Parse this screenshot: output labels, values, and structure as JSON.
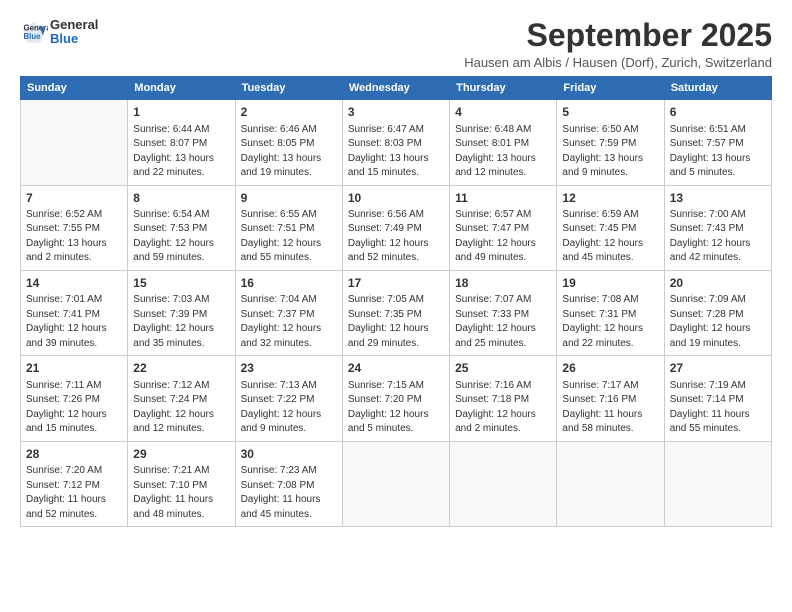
{
  "header": {
    "logo_general": "General",
    "logo_blue": "Blue",
    "month_title": "September 2025",
    "location": "Hausen am Albis / Hausen (Dorf), Zurich, Switzerland"
  },
  "days_of_week": [
    "Sunday",
    "Monday",
    "Tuesday",
    "Wednesday",
    "Thursday",
    "Friday",
    "Saturday"
  ],
  "weeks": [
    [
      {
        "day": "",
        "info": ""
      },
      {
        "day": "1",
        "info": "Sunrise: 6:44 AM\nSunset: 8:07 PM\nDaylight: 13 hours\nand 22 minutes."
      },
      {
        "day": "2",
        "info": "Sunrise: 6:46 AM\nSunset: 8:05 PM\nDaylight: 13 hours\nand 19 minutes."
      },
      {
        "day": "3",
        "info": "Sunrise: 6:47 AM\nSunset: 8:03 PM\nDaylight: 13 hours\nand 15 minutes."
      },
      {
        "day": "4",
        "info": "Sunrise: 6:48 AM\nSunset: 8:01 PM\nDaylight: 13 hours\nand 12 minutes."
      },
      {
        "day": "5",
        "info": "Sunrise: 6:50 AM\nSunset: 7:59 PM\nDaylight: 13 hours\nand 9 minutes."
      },
      {
        "day": "6",
        "info": "Sunrise: 6:51 AM\nSunset: 7:57 PM\nDaylight: 13 hours\nand 5 minutes."
      }
    ],
    [
      {
        "day": "7",
        "info": "Sunrise: 6:52 AM\nSunset: 7:55 PM\nDaylight: 13 hours\nand 2 minutes."
      },
      {
        "day": "8",
        "info": "Sunrise: 6:54 AM\nSunset: 7:53 PM\nDaylight: 12 hours\nand 59 minutes."
      },
      {
        "day": "9",
        "info": "Sunrise: 6:55 AM\nSunset: 7:51 PM\nDaylight: 12 hours\nand 55 minutes."
      },
      {
        "day": "10",
        "info": "Sunrise: 6:56 AM\nSunset: 7:49 PM\nDaylight: 12 hours\nand 52 minutes."
      },
      {
        "day": "11",
        "info": "Sunrise: 6:57 AM\nSunset: 7:47 PM\nDaylight: 12 hours\nand 49 minutes."
      },
      {
        "day": "12",
        "info": "Sunrise: 6:59 AM\nSunset: 7:45 PM\nDaylight: 12 hours\nand 45 minutes."
      },
      {
        "day": "13",
        "info": "Sunrise: 7:00 AM\nSunset: 7:43 PM\nDaylight: 12 hours\nand 42 minutes."
      }
    ],
    [
      {
        "day": "14",
        "info": "Sunrise: 7:01 AM\nSunset: 7:41 PM\nDaylight: 12 hours\nand 39 minutes."
      },
      {
        "day": "15",
        "info": "Sunrise: 7:03 AM\nSunset: 7:39 PM\nDaylight: 12 hours\nand 35 minutes."
      },
      {
        "day": "16",
        "info": "Sunrise: 7:04 AM\nSunset: 7:37 PM\nDaylight: 12 hours\nand 32 minutes."
      },
      {
        "day": "17",
        "info": "Sunrise: 7:05 AM\nSunset: 7:35 PM\nDaylight: 12 hours\nand 29 minutes."
      },
      {
        "day": "18",
        "info": "Sunrise: 7:07 AM\nSunset: 7:33 PM\nDaylight: 12 hours\nand 25 minutes."
      },
      {
        "day": "19",
        "info": "Sunrise: 7:08 AM\nSunset: 7:31 PM\nDaylight: 12 hours\nand 22 minutes."
      },
      {
        "day": "20",
        "info": "Sunrise: 7:09 AM\nSunset: 7:28 PM\nDaylight: 12 hours\nand 19 minutes."
      }
    ],
    [
      {
        "day": "21",
        "info": "Sunrise: 7:11 AM\nSunset: 7:26 PM\nDaylight: 12 hours\nand 15 minutes."
      },
      {
        "day": "22",
        "info": "Sunrise: 7:12 AM\nSunset: 7:24 PM\nDaylight: 12 hours\nand 12 minutes."
      },
      {
        "day": "23",
        "info": "Sunrise: 7:13 AM\nSunset: 7:22 PM\nDaylight: 12 hours\nand 9 minutes."
      },
      {
        "day": "24",
        "info": "Sunrise: 7:15 AM\nSunset: 7:20 PM\nDaylight: 12 hours\nand 5 minutes."
      },
      {
        "day": "25",
        "info": "Sunrise: 7:16 AM\nSunset: 7:18 PM\nDaylight: 12 hours\nand 2 minutes."
      },
      {
        "day": "26",
        "info": "Sunrise: 7:17 AM\nSunset: 7:16 PM\nDaylight: 11 hours\nand 58 minutes."
      },
      {
        "day": "27",
        "info": "Sunrise: 7:19 AM\nSunset: 7:14 PM\nDaylight: 11 hours\nand 55 minutes."
      }
    ],
    [
      {
        "day": "28",
        "info": "Sunrise: 7:20 AM\nSunset: 7:12 PM\nDaylight: 11 hours\nand 52 minutes."
      },
      {
        "day": "29",
        "info": "Sunrise: 7:21 AM\nSunset: 7:10 PM\nDaylight: 11 hours\nand 48 minutes."
      },
      {
        "day": "30",
        "info": "Sunrise: 7:23 AM\nSunset: 7:08 PM\nDaylight: 11 hours\nand 45 minutes."
      },
      {
        "day": "",
        "info": ""
      },
      {
        "day": "",
        "info": ""
      },
      {
        "day": "",
        "info": ""
      },
      {
        "day": "",
        "info": ""
      }
    ]
  ]
}
